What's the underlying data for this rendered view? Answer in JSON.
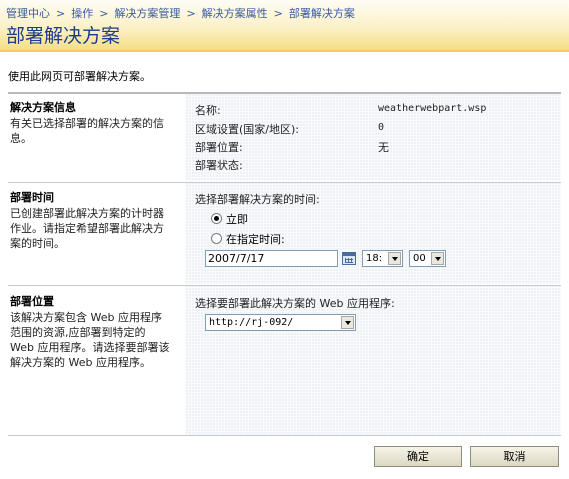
{
  "breadcrumb": {
    "items": [
      "管理中心",
      "操作",
      "解决方案管理",
      "解决方案属性"
    ],
    "separator": ">",
    "current": "部署解决方案"
  },
  "page_title": "部署解决方案",
  "intro": "使用此网页可部署解决方案。",
  "sections": {
    "info": {
      "title": "解决方案信息",
      "desc": "有关已选择部署的解决方案的信息。",
      "name_label": "名称:",
      "name_value": "weatherwebpart.wsp",
      "locale_label": "区域设置(国家/地区):",
      "locale_value": "0",
      "deployed_to_label": "部署位置:",
      "deployed_to_value": "无",
      "status_label": "部署状态:",
      "status_value": ""
    },
    "time": {
      "title": "部署时间",
      "desc": "已创建部署此解决方案的计时器作业。请指定希望部署此解决方案的时间。",
      "prompt": "选择部署解决方案的时间:",
      "now_label": "立即",
      "specific_label": "在指定时间:",
      "date_value": "2007/7/17",
      "hour_value": "18:",
      "minute_value": "00"
    },
    "location": {
      "title": "部署位置",
      "desc": "该解决方案包含 Web 应用程序范围的资源,应部署到特定的 Web 应用程序。请选择要部署该解决方案的 Web 应用程序。",
      "prompt": "选择要部署此解决方案的 Web 应用程序:",
      "webapp_value": "http://rj-092/"
    }
  },
  "buttons": {
    "ok": "确定",
    "cancel": "取消"
  }
}
